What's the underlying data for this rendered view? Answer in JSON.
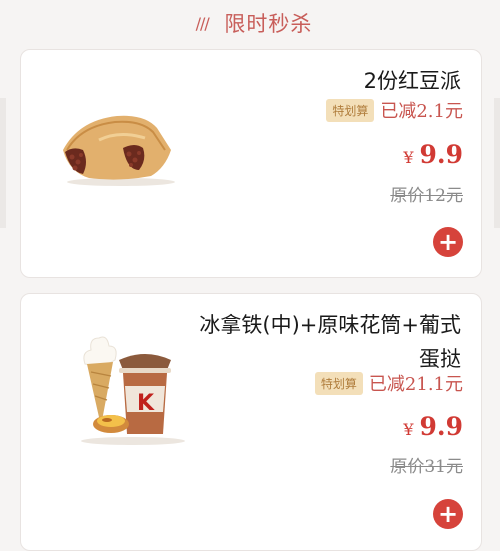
{
  "header": {
    "title": "限时秒杀",
    "decoration": "///"
  },
  "products": [
    {
      "name": "2份红豆派",
      "tag": "特划算",
      "discount": "已减2.1元",
      "currency": "¥",
      "price": "9.9",
      "original_price": "原价12元",
      "image_icon": "red-bean-pie-image"
    },
    {
      "name_line1": "冰拿铁(中)+原味花筒+葡式",
      "name_line2": "蛋挞",
      "tag": "特划算",
      "discount": "已减21.1元",
      "currency": "¥",
      "price": "9.9",
      "original_price": "原价31元",
      "image_icon": "coffee-cone-tart-image"
    }
  ],
  "colors": {
    "accent": "#d6433b",
    "tag_bg": "#f3dfb9",
    "tag_text": "#b07d3c",
    "header": "#c85e5a"
  }
}
